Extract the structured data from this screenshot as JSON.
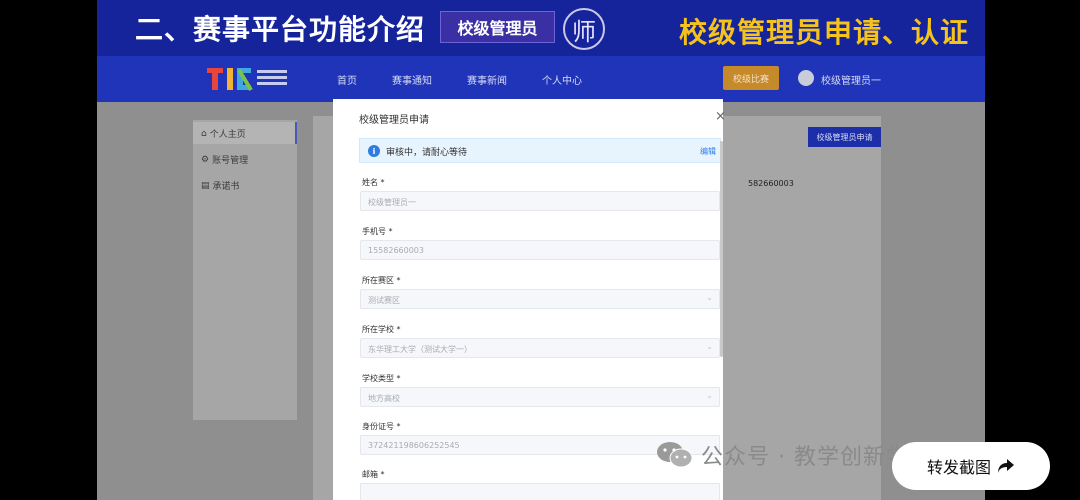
{
  "banner": {
    "title": "二、赛事平台功能介绍",
    "tag": "校级管理员",
    "seal_glyph": "师",
    "right_title": "校级管理员申请、认证"
  },
  "nav": {
    "items": [
      "首页",
      "赛事通知",
      "赛事新闻",
      "个人中心"
    ],
    "cta": "校级比赛",
    "user": "校级管理员一"
  },
  "sidebar": {
    "items": [
      {
        "label": "个人主页",
        "icon": "home-icon"
      },
      {
        "label": "账号管理",
        "icon": "gear-icon"
      },
      {
        "label": "承诺书",
        "icon": "document-icon"
      }
    ]
  },
  "background": {
    "apply_button": "校级管理员申请",
    "phone_partial": "582660003"
  },
  "modal": {
    "title": "校级管理员申请",
    "close": "×",
    "alert": {
      "icon": "i",
      "text": "审核中，请耐心等待",
      "edit": "编辑"
    },
    "fields": [
      {
        "label": "姓名 *",
        "value": "校级管理员一",
        "select": false
      },
      {
        "label": "手机号 *",
        "value": "15582660003",
        "select": false
      },
      {
        "label": "所在赛区 *",
        "value": "测试赛区",
        "select": true
      },
      {
        "label": "所在学校 *",
        "value": "东华理工大学（测试大学一）",
        "select": true
      },
      {
        "label": "学校类型 *",
        "value": "地方高校",
        "select": true
      },
      {
        "label": "身份证号 *",
        "value": "372421198606252545",
        "select": false
      },
      {
        "label": "邮箱 *",
        "value": "",
        "select": false
      }
    ]
  },
  "watermark": {
    "text": "公众号 · 教学创新学习圈"
  },
  "share": {
    "label": "转发截图",
    "icon": "share-arrow-icon"
  },
  "colors": {
    "banner": "#15249a",
    "nav": "#1f34b8",
    "accent_yellow": "#f6c21c",
    "info_blue": "#2f7de1"
  }
}
